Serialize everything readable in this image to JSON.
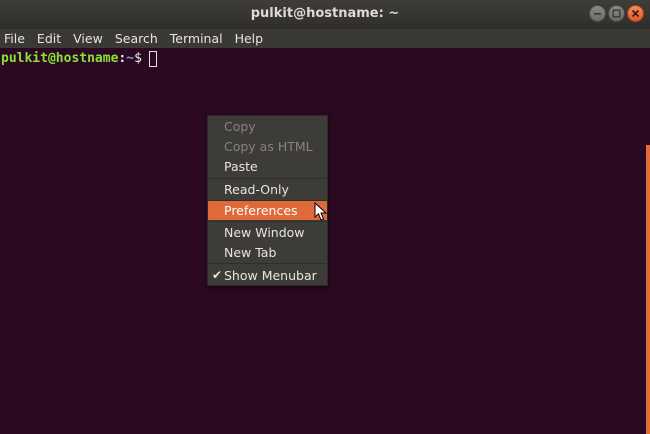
{
  "window": {
    "title": "pulkit@hostname: ~"
  },
  "menubar": {
    "items": [
      "File",
      "Edit",
      "View",
      "Search",
      "Terminal",
      "Help"
    ]
  },
  "terminal": {
    "prompt_user": "pulkit@hostname",
    "prompt_colon": ":",
    "prompt_path": "~",
    "prompt_dollar": "$"
  },
  "context_menu": {
    "items": [
      {
        "label": "Copy",
        "enabled": false
      },
      {
        "label": "Copy as HTML",
        "enabled": false
      },
      {
        "label": "Paste",
        "enabled": true
      },
      {
        "label": "Read-Only",
        "enabled": true
      },
      {
        "label": "Preferences",
        "enabled": true,
        "highlighted": true
      },
      {
        "label": "New Window",
        "enabled": true
      },
      {
        "label": "New Tab",
        "enabled": true
      },
      {
        "label": "Show Menubar",
        "enabled": true,
        "checked": true
      }
    ]
  },
  "colors": {
    "terminal_bg": "#2c0922",
    "accent": "#e0693a",
    "prompt_user": "#8ae234",
    "prompt_path": "#729fcf"
  },
  "icons": {
    "check": "check-icon",
    "pointer": "mouse-pointer-icon"
  }
}
